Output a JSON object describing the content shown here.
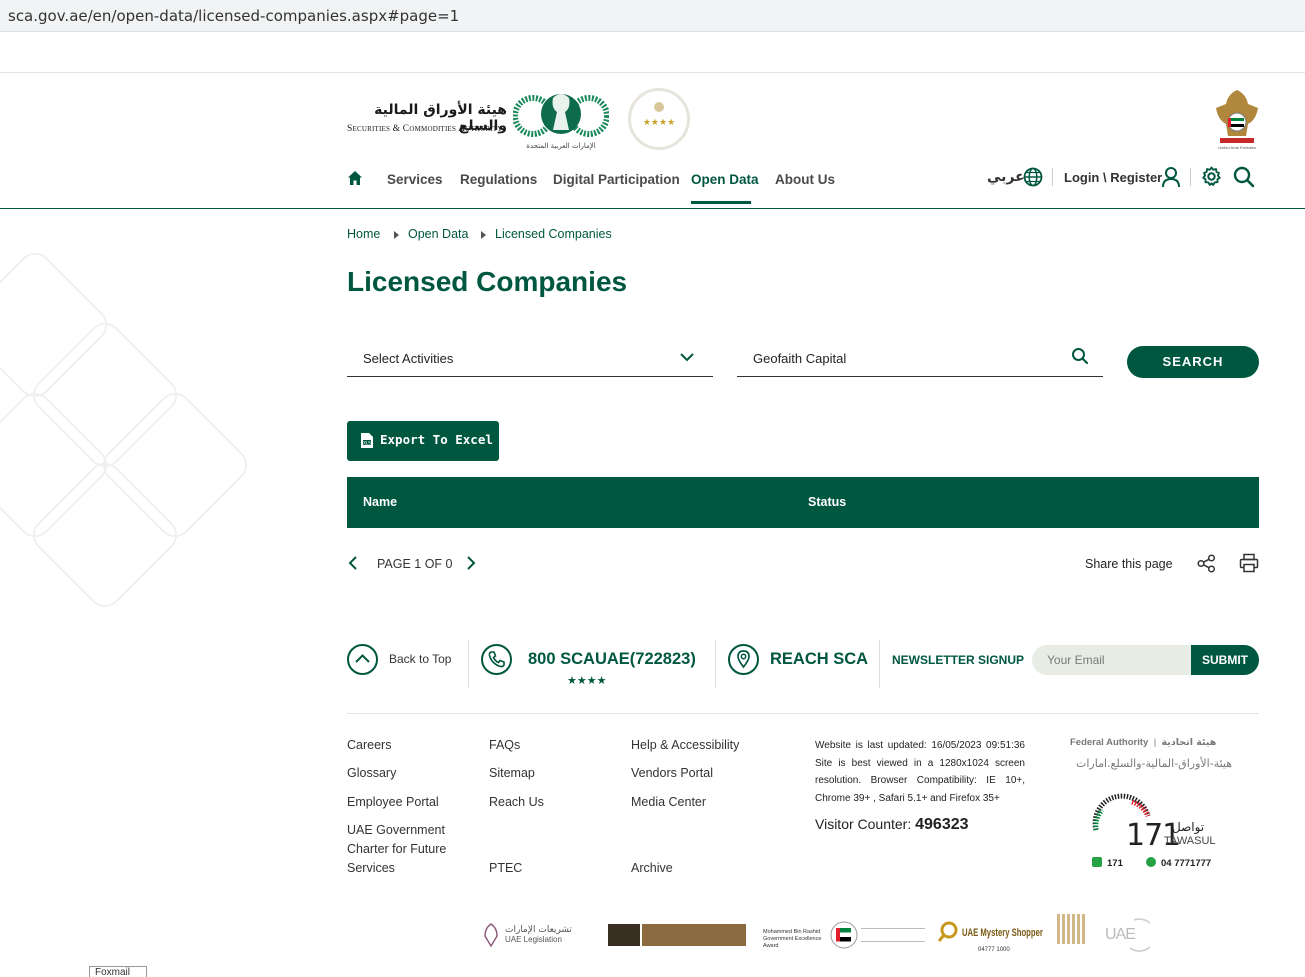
{
  "browser": {
    "url": "sca.gov.ae/en/open-data/licensed-companies.aspx#page=1"
  },
  "header": {
    "logo_ar": "هيئة الأوراق المالية والسلع",
    "logo_en": "Securities & Commodities Authority",
    "nav": [
      {
        "label": "Services"
      },
      {
        "label": "Regulations"
      },
      {
        "label": "Digital Participation"
      },
      {
        "label": "Open Data"
      },
      {
        "label": "About Us"
      }
    ],
    "active_nav": "Open Data",
    "language_label": "عربي",
    "login_label": "Login \\ Register"
  },
  "breadcrumb": [
    "Home",
    "Open Data",
    "Licensed Companies"
  ],
  "page_title": "Licensed Companies",
  "filters": {
    "activity_label": "Select Activities",
    "search_value": "Geofaith Capital",
    "search_button": "SEARCH"
  },
  "export_label": "Export To Excel",
  "table": {
    "columns": [
      "Name",
      "Status"
    ],
    "rows": []
  },
  "pager": {
    "text": "PAGE 1 OF 0"
  },
  "share_label": "Share this page",
  "contact": {
    "back_to_top": "Back to Top",
    "phone": "800 SCAUAE(722823)",
    "stars": "★★★★",
    "reach": "REACH SCA",
    "newsletter_label": "NEWSLETTER SIGNUP",
    "email_placeholder": "Your Email",
    "submit_label": "SUBMIT"
  },
  "footer": {
    "col1": [
      "Careers",
      "Glossary",
      "Employee Portal",
      "UAE Government Charter for Future Services"
    ],
    "col2": [
      "FAQs",
      "Sitemap",
      "Reach Us",
      "PTEC"
    ],
    "col3": [
      "Help & Accessibility",
      "Vendors Portal",
      "Media Center",
      "Archive"
    ],
    "meta": "Website is last updated: 16/05/2023 09:51:36 Site is best viewed in a 1280x1024 screen resolution. Browser Compatibility: IE 10+, Chrome 39+ , Safari 5.1+ and Firefox 35+",
    "visitor_label": "Visitor Counter:",
    "visitor_count": "496323",
    "federal_en": "Federal Authority",
    "federal_ar": "هيئة اتحادية",
    "federal_ar2": "هيئة-الأوراق-المالية-والسلع.امارات",
    "tawasul_number": "171",
    "tawasul_en": "TAWASUL",
    "tawasul_ar": "تواصل",
    "tawasul_phone1": "171",
    "tawasul_phone2": "04 7771777",
    "partners": [
      "UAE Legislation",
      "Mohammed Bin Rashid Government Excellence Award",
      "UAE Mystery Shopper",
      "UAE"
    ],
    "mystery_phone": "04777 1000"
  },
  "overlay": {
    "foxmail": "Foxmail"
  },
  "colors": {
    "primary": "#00573f",
    "input_bg": "#e7ede5"
  }
}
